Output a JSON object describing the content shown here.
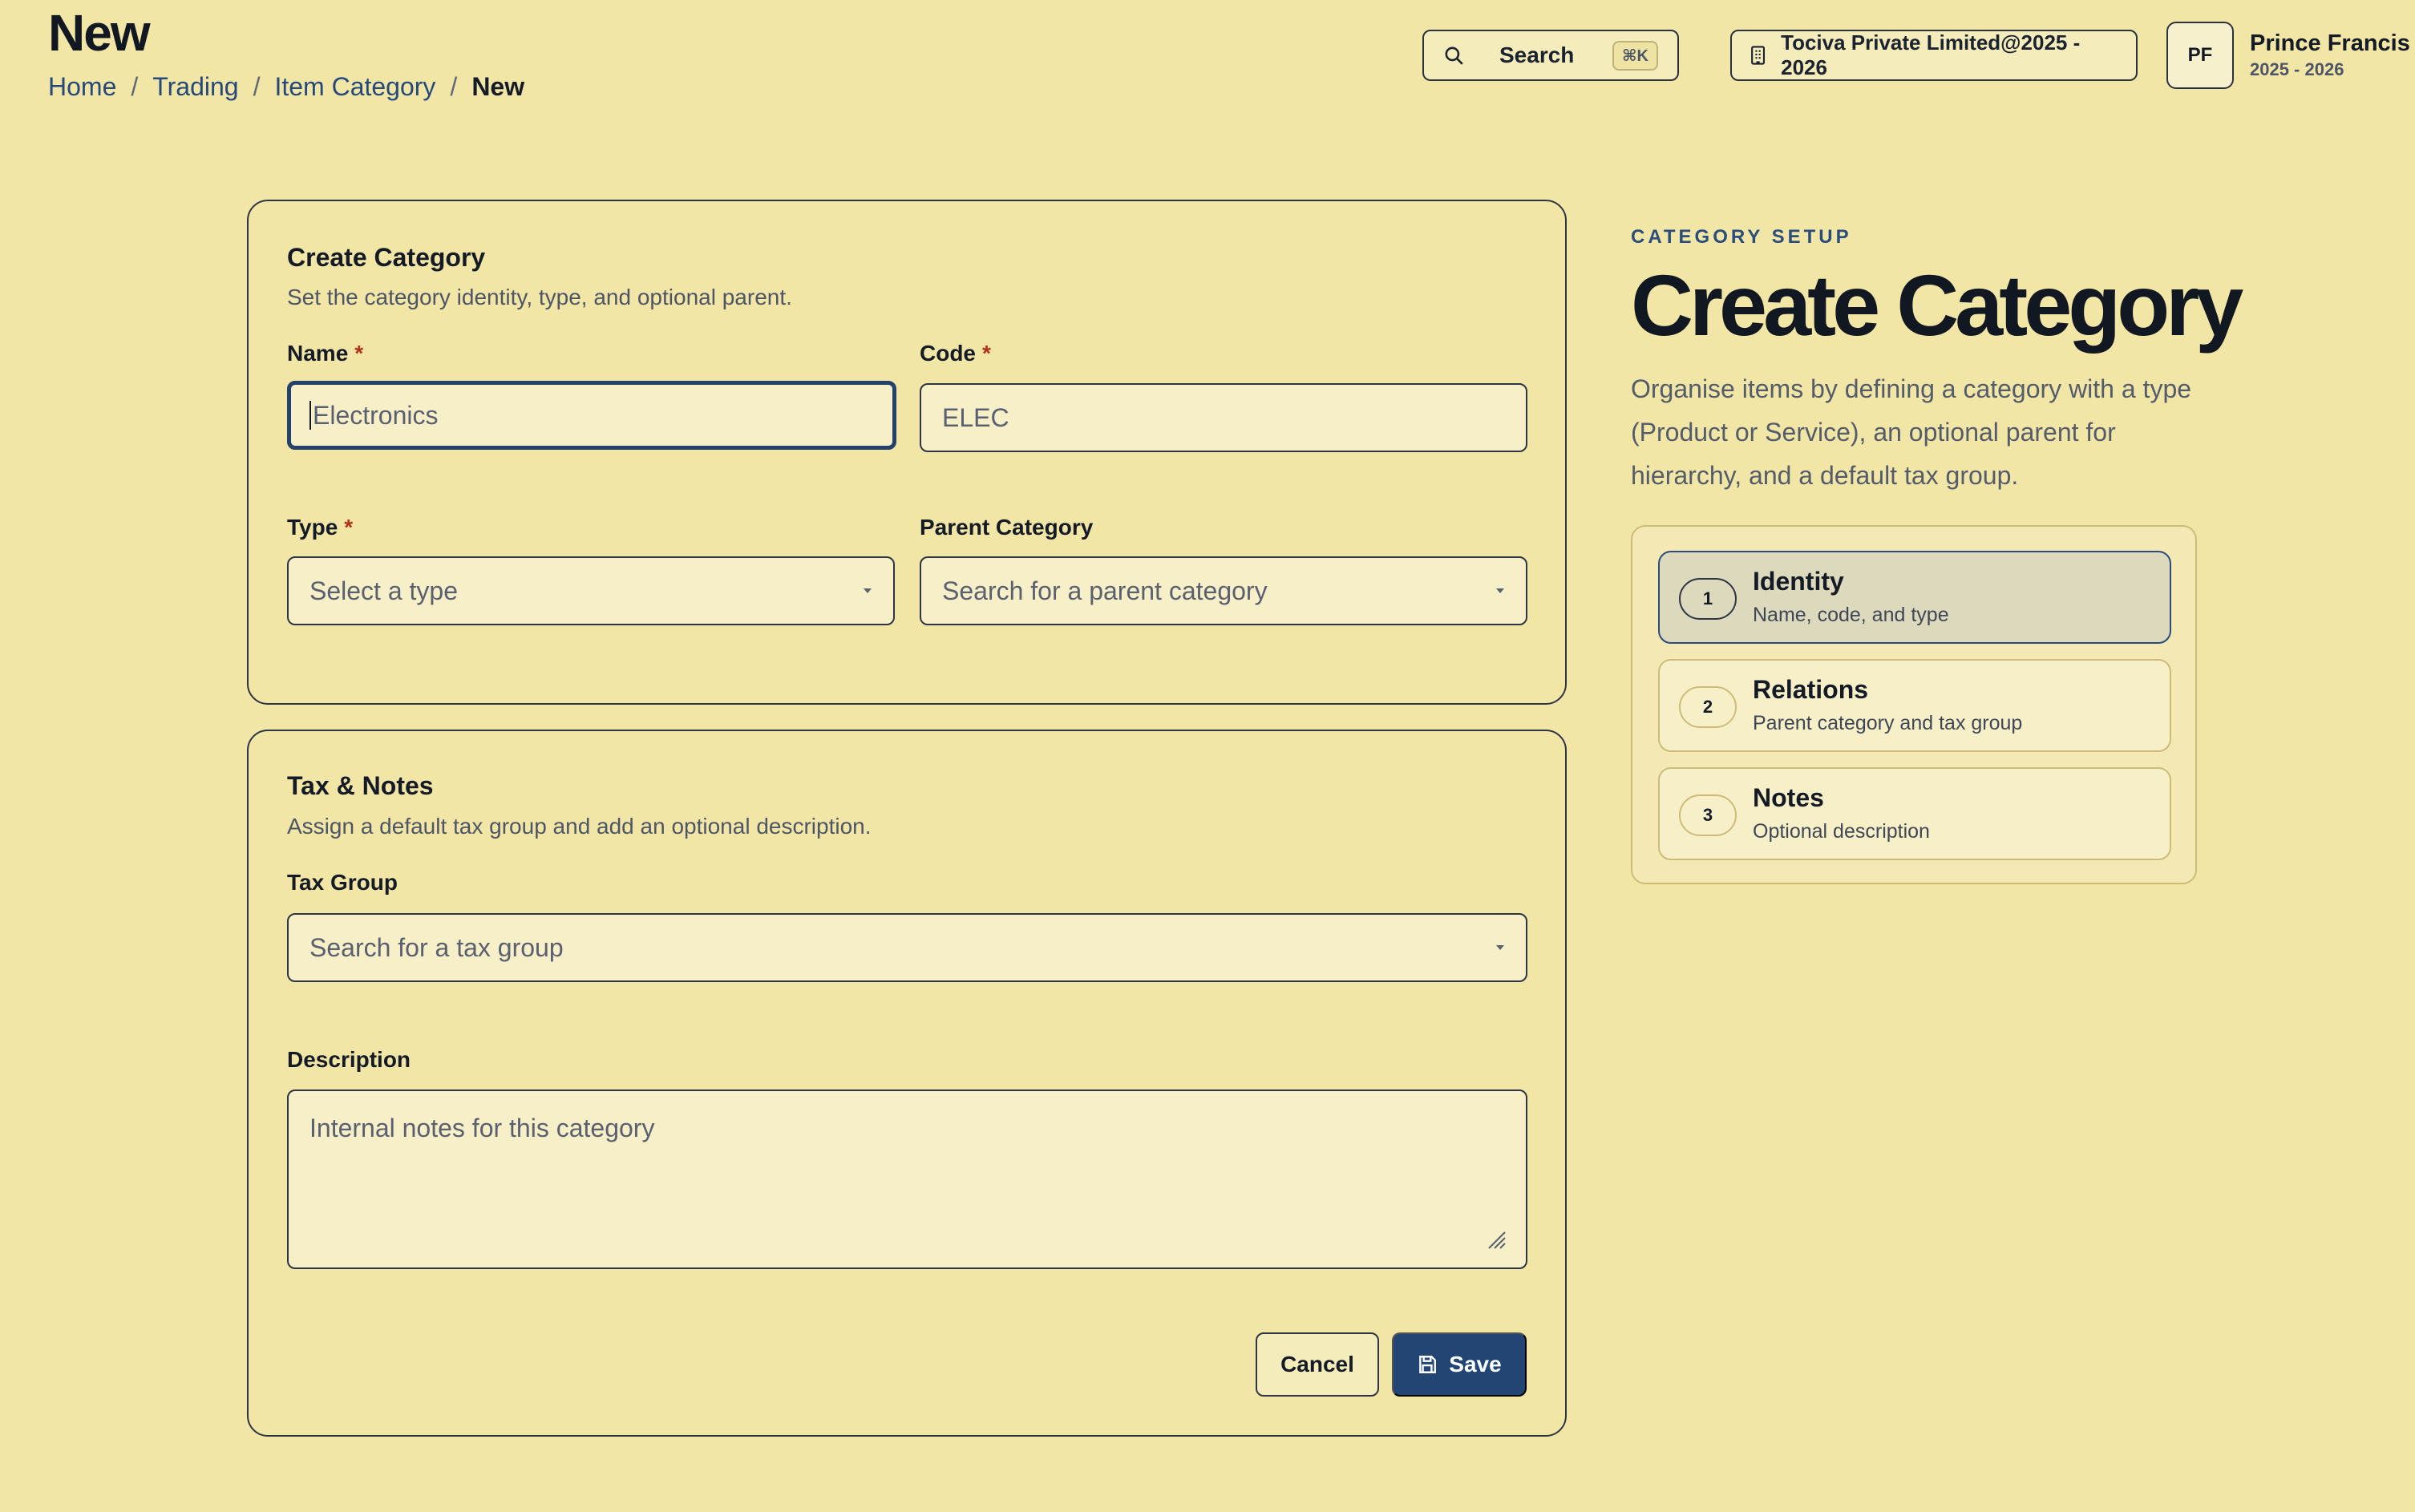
{
  "header": {
    "title": "New",
    "breadcrumb": [
      "Home",
      "Trading",
      "Item Category",
      "New"
    ],
    "search_label": "Search",
    "search_shortcut": "⌘K",
    "company": "Tociva Private Limited@2025 - 2026",
    "user_initials": "PF",
    "user_name": "Prince Francis",
    "user_year": "2025 - 2026"
  },
  "create_card": {
    "title": "Create Category",
    "description": "Set the category identity, type, and optional parent.",
    "name_label": "Name",
    "name_placeholder": "Electronics",
    "code_label": "Code",
    "code_placeholder": "ELEC",
    "type_label": "Type",
    "type_placeholder": "Select a type",
    "parent_label": "Parent Category",
    "parent_placeholder": "Search for a parent category",
    "required_mark": "*"
  },
  "tax_card": {
    "title": "Tax & Notes",
    "description": "Assign a default tax group and add an optional description.",
    "tax_label": "Tax Group",
    "tax_placeholder": "Search for a tax group",
    "desc_label": "Description",
    "desc_placeholder": "Internal notes for this category",
    "cancel_label": "Cancel",
    "save_label": "Save"
  },
  "side_panel": {
    "eyebrow": "CATEGORY SETUP",
    "title": "Create Category",
    "description": "Organise items by defining a category with a type (Product or Service), an optional parent for hierarchy, and a default tax group.",
    "steps": [
      {
        "num": "1",
        "title": "Identity",
        "desc": "Name, code, and type",
        "active": true
      },
      {
        "num": "2",
        "title": "Relations",
        "desc": "Parent category and tax group",
        "active": false
      },
      {
        "num": "3",
        "title": "Notes",
        "desc": "Optional description",
        "active": false
      }
    ]
  },
  "colors": {
    "background": "#f2e6a6",
    "primary": "#234574",
    "link": "#25497a",
    "required": "#b0321c"
  }
}
